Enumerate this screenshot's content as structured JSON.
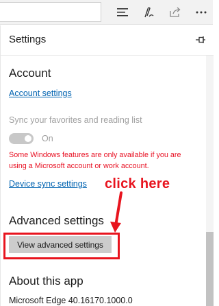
{
  "toolbar": {
    "icons": [
      "hub-icon",
      "web-note-icon",
      "share-icon",
      "more-icon"
    ]
  },
  "settings": {
    "title": "Settings",
    "account": {
      "heading": "Account",
      "account_settings_link": "Account settings",
      "sync_label": "Sync your favorites and reading list",
      "sync_toggle_state": "On",
      "warning": "Some Windows features are only available if you are using a Microsoft account or work account.",
      "device_sync_link": "Device sync settings"
    },
    "advanced": {
      "heading": "Advanced settings",
      "button_label": "View advanced settings"
    },
    "about": {
      "heading": "About this app",
      "version": "Microsoft Edge 40.16170.1000.0"
    }
  },
  "annotation": {
    "callout": "click here",
    "color": "#e8141e"
  }
}
